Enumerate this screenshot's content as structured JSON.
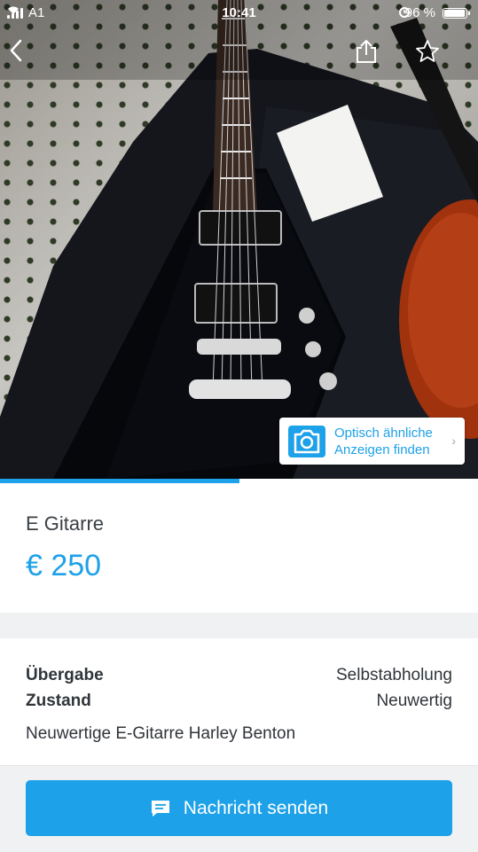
{
  "status_bar": {
    "carrier": "A1",
    "time": "10:41",
    "battery": "96 %"
  },
  "photo": {
    "progress_fraction": 0.5
  },
  "visual_search": {
    "line1": "Optisch ähnliche",
    "line2": "Anzeigen finden"
  },
  "listing": {
    "title": "E Gitarre",
    "price": "€ 250"
  },
  "details": {
    "rows": [
      {
        "key": "Übergabe",
        "value": "Selbstabholung"
      },
      {
        "key": "Zustand",
        "value": "Neuwertig"
      }
    ],
    "description": "Neuwertige E-Gitarre Harley Benton"
  },
  "actions": {
    "send_label": "Nachricht senden"
  },
  "icons": {
    "back": "chevron-left-icon",
    "share": "share-icon",
    "favorite": "star-icon",
    "camera": "camera-icon",
    "message": "message-icon"
  },
  "colors": {
    "accent": "#1da1e8",
    "text": "#30353a"
  }
}
